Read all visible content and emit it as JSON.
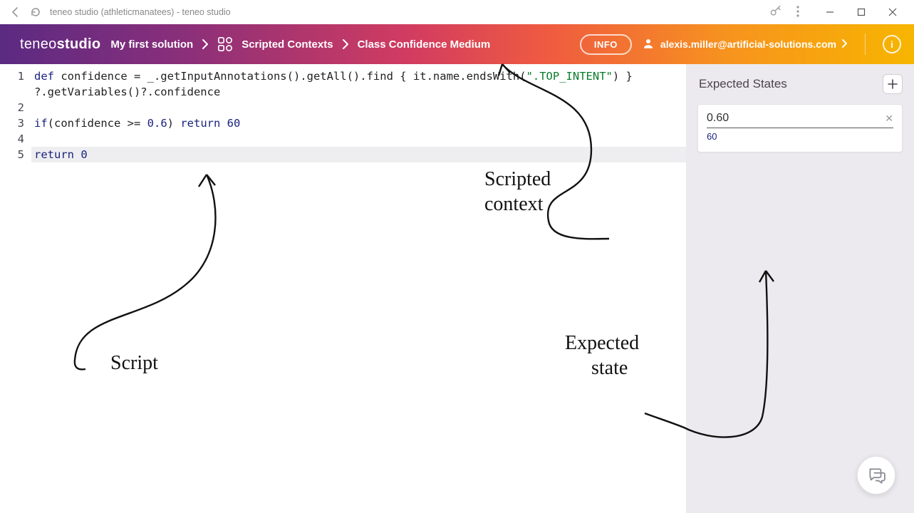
{
  "window": {
    "title": "teneo studio (athleticmanatees) - teneo studio"
  },
  "header": {
    "logo_light": "teneo",
    "logo_bold": "studio",
    "breadcrumb": [
      "My first solution",
      "Scripted Contexts",
      "Class Confidence Medium"
    ],
    "info_label": "INFO",
    "user_email": "alexis.miller@artificial-solutions.com"
  },
  "code": {
    "lines": [
      {
        "n": "1",
        "segments": [
          {
            "t": "def",
            "c": "kw"
          },
          {
            "t": " confidence = _.getInputAnnotations().getAll().find { it.name.endsWith(",
            "c": "plain"
          },
          {
            "t": "\".TOP_INTENT\"",
            "c": "str"
          },
          {
            "t": ") }",
            "c": "plain"
          }
        ]
      },
      {
        "n": " ",
        "segments": [
          {
            "t": "?.getVariables()?.confidence",
            "c": "plain"
          }
        ]
      },
      {
        "n": "2",
        "segments": [
          {
            "t": "",
            "c": "plain"
          }
        ]
      },
      {
        "n": "3",
        "segments": [
          {
            "t": "if",
            "c": "kw"
          },
          {
            "t": "(confidence >= ",
            "c": "plain"
          },
          {
            "t": "0.6",
            "c": "num"
          },
          {
            "t": ") ",
            "c": "plain"
          },
          {
            "t": "return",
            "c": "kw"
          },
          {
            "t": " ",
            "c": "plain"
          },
          {
            "t": "60",
            "c": "num"
          }
        ]
      },
      {
        "n": "4",
        "segments": [
          {
            "t": "",
            "c": "plain"
          }
        ]
      },
      {
        "n": "5",
        "highlight": true,
        "segments": [
          {
            "t": "return",
            "c": "kw"
          },
          {
            "t": " ",
            "c": "plain"
          },
          {
            "t": "0",
            "c": "num"
          }
        ]
      }
    ]
  },
  "right_panel": {
    "title": "Expected States",
    "state_value": "0.60",
    "state_result": "60"
  },
  "annotations": {
    "scripted_context": "Scripted\ncontext",
    "script": "Script",
    "expected_state": "Expected\nstate"
  }
}
